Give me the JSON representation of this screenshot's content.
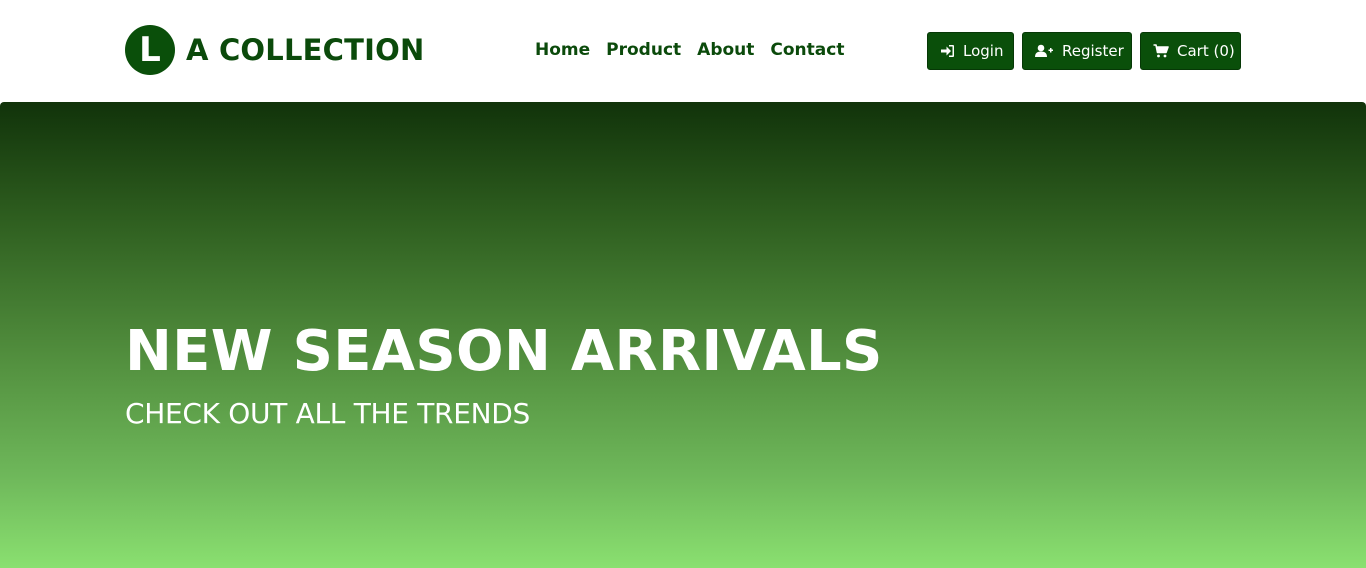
{
  "brand": {
    "mark": "L",
    "name": "A COLLECTION"
  },
  "nav": {
    "links": [
      {
        "label": "Home"
      },
      {
        "label": "Product"
      },
      {
        "label": "About"
      },
      {
        "label": "Contact"
      }
    ]
  },
  "actions": {
    "login": {
      "label": "Login",
      "icon": "sign-in-icon"
    },
    "register": {
      "label": "Register",
      "icon": "user-plus-icon"
    },
    "cart": {
      "label": "Cart (0)",
      "icon": "shopping-cart-icon"
    }
  },
  "hero": {
    "title": "NEW SEASON ARRIVALS",
    "subtitle": "CHECK OUT ALL THE TRENDS"
  },
  "colors": {
    "brand_green": "#0a4f0a",
    "hero_top": "#11330a",
    "hero_bottom": "#8ae070",
    "text_on_dark": "#ffffff"
  }
}
